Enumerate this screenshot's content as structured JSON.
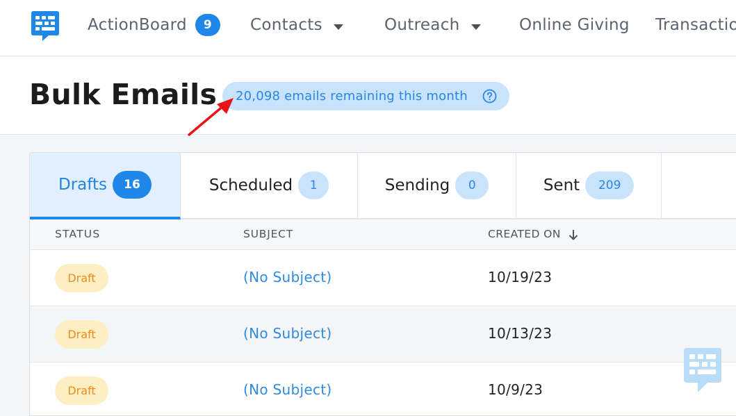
{
  "nav": {
    "items": [
      {
        "label": "ActionBoard",
        "badge": "9"
      },
      {
        "label": "Contacts"
      },
      {
        "label": "Outreach"
      },
      {
        "label": "Online Giving"
      },
      {
        "label": "Transactions"
      }
    ]
  },
  "header": {
    "title": "Bulk Emails",
    "quota": "20,098 emails remaining this month"
  },
  "tabs": [
    {
      "label": "Drafts",
      "count": "16"
    },
    {
      "label": "Scheduled",
      "count": "1"
    },
    {
      "label": "Sending",
      "count": "0"
    },
    {
      "label": "Sent",
      "count": "209"
    }
  ],
  "table": {
    "columns": [
      "STATUS",
      "SUBJECT",
      "CREATED ON"
    ],
    "rows": [
      {
        "status": "Draft",
        "subject": "(No Subject)",
        "created": "10/19/23"
      },
      {
        "status": "Draft",
        "subject": "(No Subject)",
        "created": "10/13/23"
      },
      {
        "status": "Draft",
        "subject": "(No Subject)",
        "created": "10/9/23"
      }
    ]
  },
  "colors": {
    "accent": "#1f87e8",
    "pill": "#c8e3fb",
    "draft_bg": "#fdeec3",
    "draft_text": "#ee8a1e",
    "annotation_arrow": "#e8141a"
  },
  "icons": {
    "logo": "keyboard-chat-logo-icon",
    "help": "question-circle-icon",
    "sort": "arrow-down-icon",
    "chat": "chat-widget-icon"
  }
}
